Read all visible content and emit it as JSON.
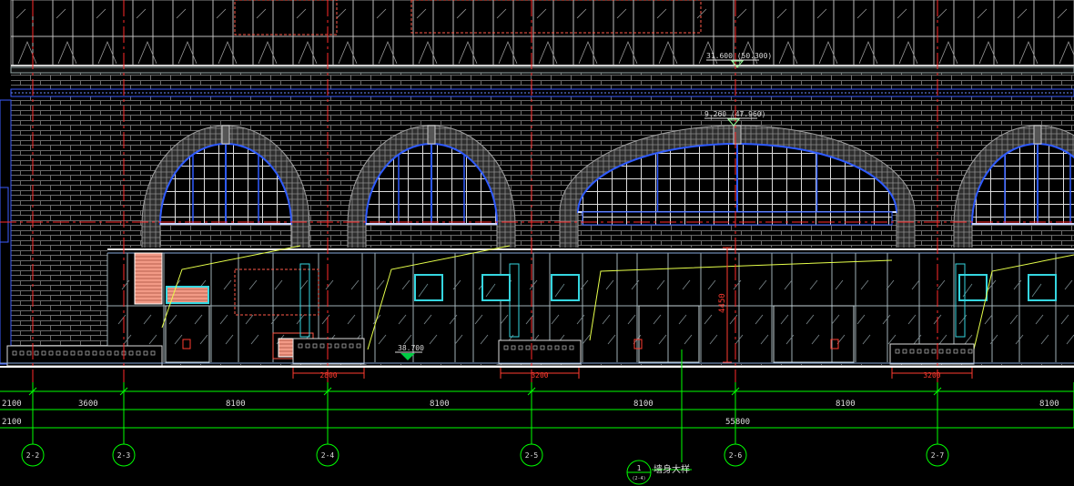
{
  "elevations": {
    "top": "31.600  (50.300)",
    "arch_top": "9.260  (47.960)",
    "ground": "38.700"
  },
  "dimensions": {
    "row1": [
      "2100",
      "3600",
      "8100",
      "8100",
      "8100",
      "8100",
      "8100"
    ],
    "row2_left": "2100",
    "row2_total": "55800",
    "stair_widths": [
      "2800",
      "3200",
      "3200"
    ],
    "door_height": "4450"
  },
  "axes": [
    "2-2",
    "2-3",
    "2-4",
    "2-5",
    "2-6",
    "2-7"
  ],
  "section_marker": {
    "number": "1",
    "label": "墙身大样",
    "sub": "(2-4)"
  },
  "colors": {
    "background": "#000000",
    "wall": "#7a7a7a",
    "axis": "#00ff00",
    "dimension": "#ff3b2f",
    "cyan": "#35d6e0",
    "window_blue": "#2f5bff",
    "hatch_pink": "#f29a86",
    "yellow": "#e6ff4a"
  }
}
